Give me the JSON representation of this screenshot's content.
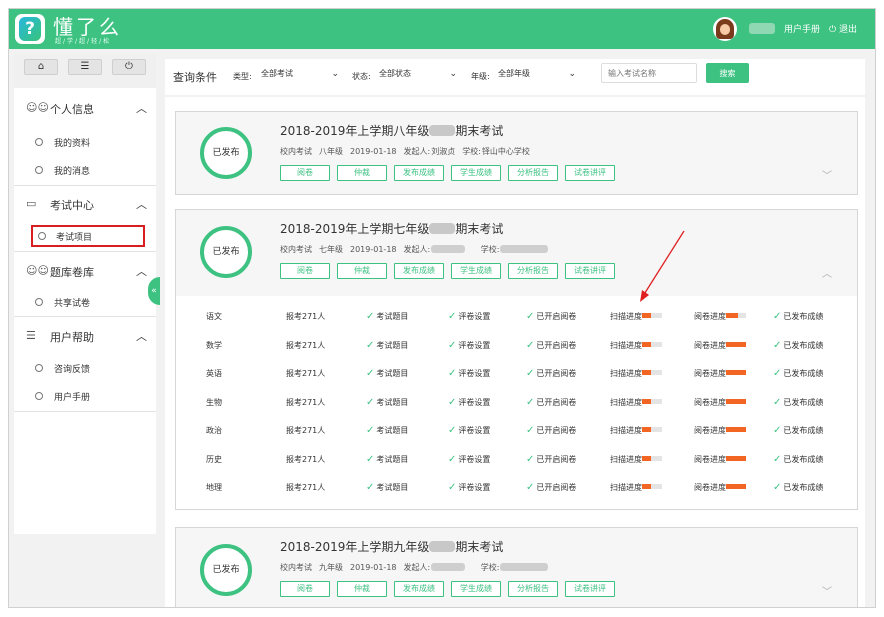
{
  "header": {
    "brand": "懂了么",
    "slogan": "超/学/超/轻/松",
    "username": "",
    "manual": "用户手册",
    "logout": "退出"
  },
  "sidebar": {
    "toolbar": [
      "home-icon",
      "list-icon",
      "power-icon"
    ],
    "sections": [
      {
        "label": "个人信息",
        "icon": "people-icon",
        "items": [
          "我的资料",
          "我的消息"
        ]
      },
      {
        "label": "考试中心",
        "icon": "monitor-icon",
        "items": [
          "考试项目"
        ]
      },
      {
        "label": "题库卷库",
        "icon": "group-icon",
        "items": [
          "共享试卷"
        ]
      },
      {
        "label": "用户帮助",
        "icon": "user-list-icon",
        "items": [
          "咨询反馈",
          "用户手册"
        ]
      }
    ]
  },
  "filter": {
    "title": "查询条件",
    "type_label": "类型:",
    "type_value": "全部考试",
    "status_label": "状态:",
    "status_value": "全部状态",
    "grade_label": "年级:",
    "grade_value": "全部年级",
    "search_placeholder": "输入考试名称",
    "search_button": "搜索"
  },
  "exams": [
    {
      "status": "已发布",
      "title_a": "2018-2019年上学期八年级",
      "title_b": "期末考试",
      "kind": "校内考试",
      "grade": "八年级",
      "date": "2019-01-18",
      "initiator_label": "发起人:",
      "initiator": "刘淑贞",
      "school_label": "学校:",
      "school": "铎山中心学校"
    },
    {
      "status": "已发布",
      "title_a": "2018-2019年上学期七年级",
      "title_b": "期末考试",
      "kind": "校内考试",
      "grade": "七年级",
      "date": "2019-01-18",
      "initiator_label": "发起人:",
      "initiator": "",
      "school_label": "学校:",
      "school": ""
    },
    {
      "status": "已发布",
      "title_a": "2018-2019年上学期九年级",
      "title_b": "期末考试",
      "kind": "校内考试",
      "grade": "九年级",
      "date": "2019-01-18",
      "initiator_label": "发起人:",
      "initiator": "",
      "school_label": "学校:",
      "school": ""
    }
  ],
  "card_buttons": [
    "阅卷",
    "仲裁",
    "发布成绩",
    "学生成绩",
    "分析报告",
    "试卷讲评"
  ],
  "subjects": [
    {
      "name": "语文",
      "count": "报考271人",
      "scan": 0.45,
      "mark": 0.6
    },
    {
      "name": "数学",
      "count": "报考271人",
      "scan": 0.45,
      "mark": 1.0
    },
    {
      "name": "英语",
      "count": "报考271人",
      "scan": 0.45,
      "mark": 1.0
    },
    {
      "name": "生物",
      "count": "报考271人",
      "scan": 0.45,
      "mark": 1.0
    },
    {
      "name": "政治",
      "count": "报考271人",
      "scan": 0.45,
      "mark": 1.0
    },
    {
      "name": "历史",
      "count": "报考271人",
      "scan": 0.45,
      "mark": 1.0
    },
    {
      "name": "地理",
      "count": "报考271人",
      "scan": 0.45,
      "mark": 1.0
    }
  ],
  "steps": {
    "exam_title": "考试题目",
    "review_settings": "评卷设置",
    "marking_open": "已开启阅卷",
    "scan_progress": "扫描进度",
    "mark_progress": "阅卷进度",
    "published": "已发布成绩"
  },
  "colors": {
    "brand": "#3dc282",
    "progress": "#f26522",
    "highlight": "#d81e1e"
  }
}
